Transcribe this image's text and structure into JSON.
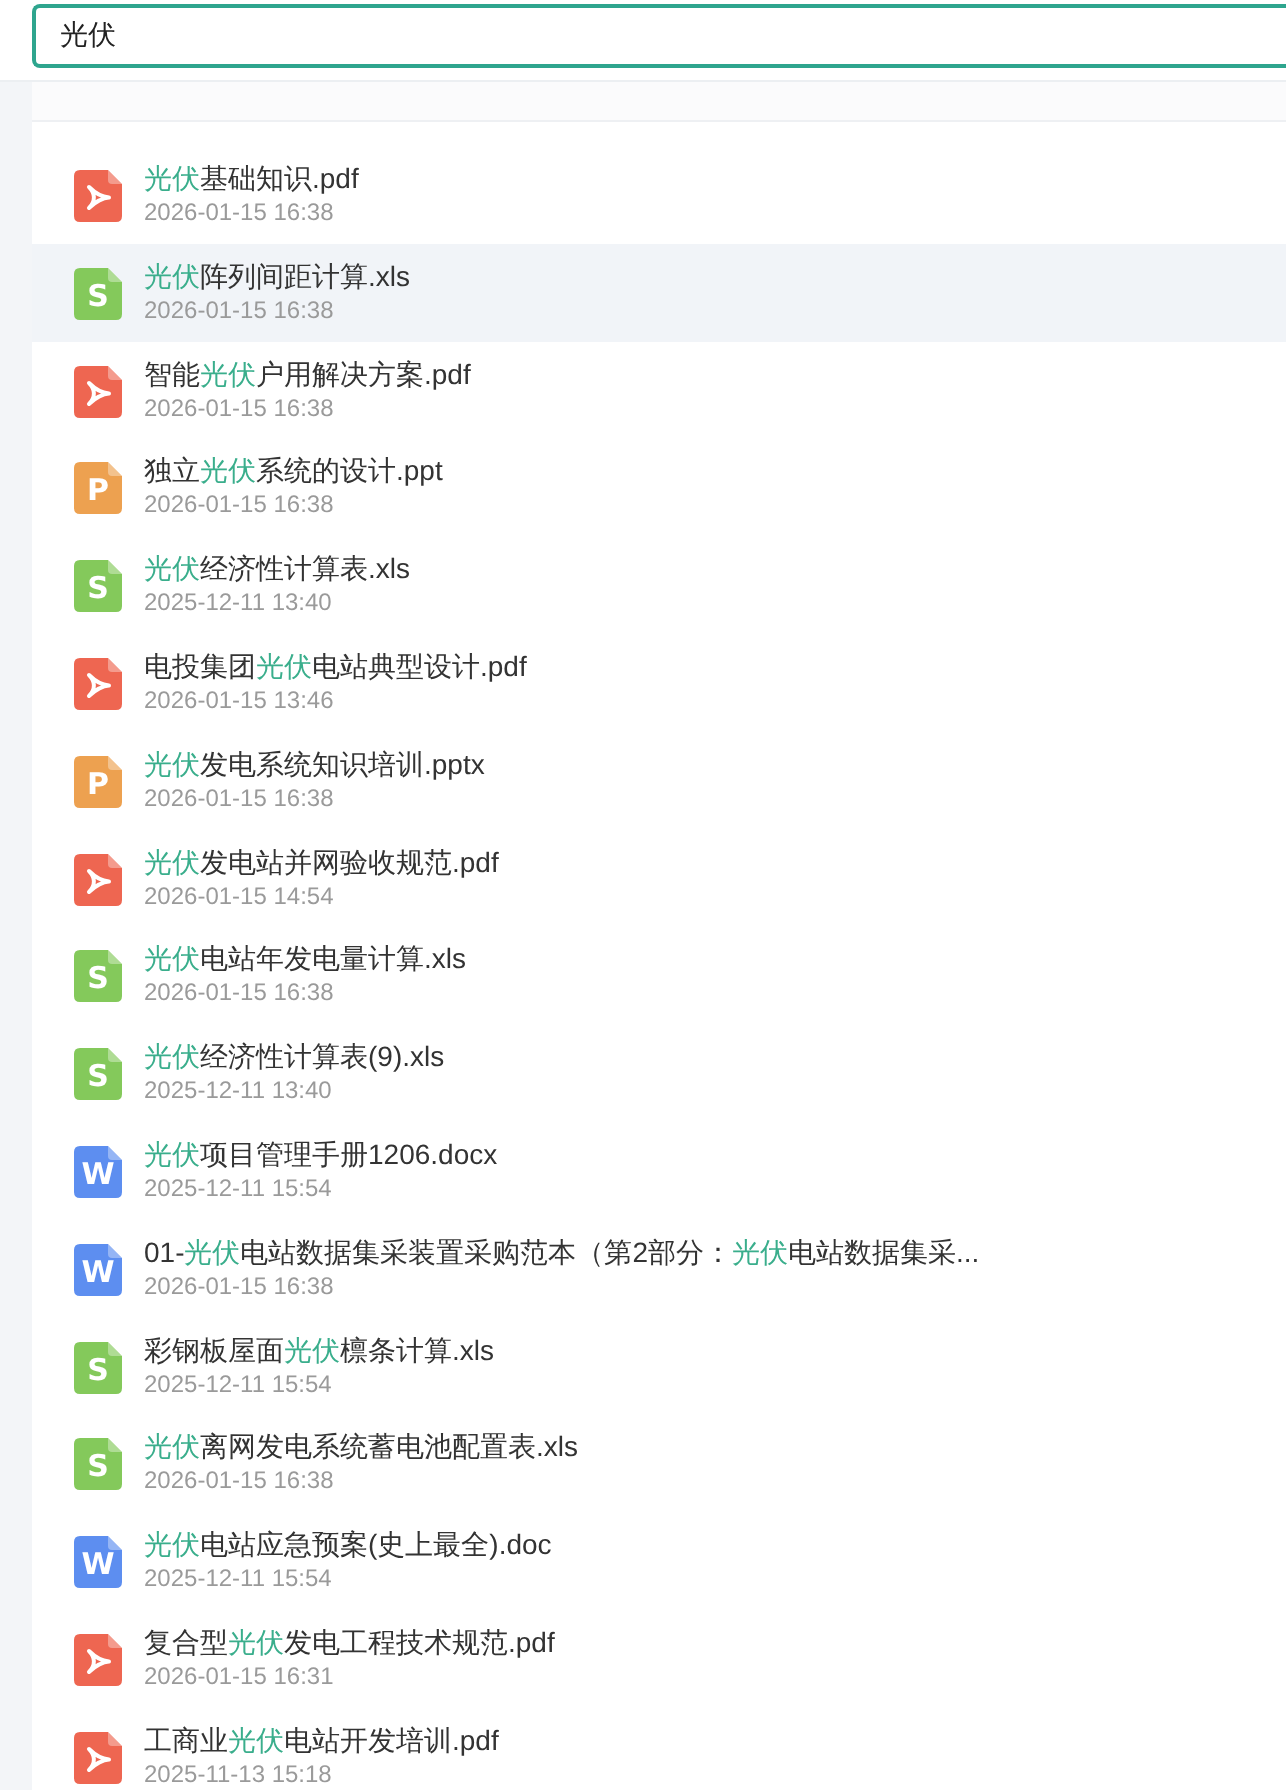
{
  "search": {
    "value": "光伏"
  },
  "results": [
    {
      "kind": "pdf",
      "name": [
        {
          "text": "光伏",
          "match": true
        },
        {
          "text": "基础知识.pdf",
          "match": false
        }
      ],
      "date": "2026-01-15 16:38",
      "selected": false
    },
    {
      "kind": "xls",
      "icon_letter": "S",
      "name": [
        {
          "text": "光伏",
          "match": true
        },
        {
          "text": "阵列间距计算.xls",
          "match": false
        }
      ],
      "date": "2026-01-15 16:38",
      "selected": true
    },
    {
      "kind": "pdf",
      "name": [
        {
          "text": "智能",
          "match": false
        },
        {
          "text": "光伏",
          "match": true
        },
        {
          "text": "户用解决方案.pdf",
          "match": false
        }
      ],
      "date": "2026-01-15 16:38",
      "selected": false
    },
    {
      "kind": "ppt",
      "icon_letter": "P",
      "name": [
        {
          "text": "独立",
          "match": false
        },
        {
          "text": "光伏",
          "match": true
        },
        {
          "text": "系统的设计.ppt",
          "match": false
        }
      ],
      "date": "2026-01-15 16:38",
      "selected": false
    },
    {
      "kind": "xls",
      "icon_letter": "S",
      "name": [
        {
          "text": "光伏",
          "match": true
        },
        {
          "text": "经济性计算表.xls",
          "match": false
        }
      ],
      "date": "2025-12-11 13:40",
      "selected": false
    },
    {
      "kind": "pdf",
      "name": [
        {
          "text": "电投集团",
          "match": false
        },
        {
          "text": "光伏",
          "match": true
        },
        {
          "text": "电站典型设计.pdf",
          "match": false
        }
      ],
      "date": "2026-01-15 13:46",
      "selected": false
    },
    {
      "kind": "ppt",
      "icon_letter": "P",
      "name": [
        {
          "text": "光伏",
          "match": true
        },
        {
          "text": "发电系统知识培训.pptx",
          "match": false
        }
      ],
      "date": "2026-01-15 16:38",
      "selected": false
    },
    {
      "kind": "pdf",
      "name": [
        {
          "text": "光伏",
          "match": true
        },
        {
          "text": "发电站并网验收规范.pdf",
          "match": false
        }
      ],
      "date": "2026-01-15 14:54",
      "selected": false
    },
    {
      "kind": "xls",
      "icon_letter": "S",
      "name": [
        {
          "text": "光伏",
          "match": true
        },
        {
          "text": "电站年发电量计算.xls",
          "match": false
        }
      ],
      "date": "2026-01-15 16:38",
      "selected": false
    },
    {
      "kind": "xls",
      "icon_letter": "S",
      "name": [
        {
          "text": "光伏",
          "match": true
        },
        {
          "text": "经济性计算表(9).xls",
          "match": false
        }
      ],
      "date": "2025-12-11 13:40",
      "selected": false
    },
    {
      "kind": "doc",
      "icon_letter": "W",
      "name": [
        {
          "text": "光伏",
          "match": true
        },
        {
          "text": "项目管理手册1206.docx",
          "match": false
        }
      ],
      "date": "2025-12-11 15:54",
      "selected": false
    },
    {
      "kind": "doc",
      "icon_letter": "W",
      "name": [
        {
          "text": "01-",
          "match": false
        },
        {
          "text": "光伏",
          "match": true
        },
        {
          "text": "电站数据集采装置采购范本（第2部分：",
          "match": false
        },
        {
          "text": "光伏",
          "match": true
        },
        {
          "text": "电站数据集采...",
          "match": false
        }
      ],
      "date": "2026-01-15 16:38",
      "selected": false
    },
    {
      "kind": "xls",
      "icon_letter": "S",
      "name": [
        {
          "text": "彩钢板屋面",
          "match": false
        },
        {
          "text": "光伏",
          "match": true
        },
        {
          "text": "檩条计算.xls",
          "match": false
        }
      ],
      "date": "2025-12-11 15:54",
      "selected": false
    },
    {
      "kind": "xls",
      "icon_letter": "S",
      "name": [
        {
          "text": "光伏",
          "match": true
        },
        {
          "text": "离网发电系统蓄电池配置表.xls",
          "match": false
        }
      ],
      "date": "2026-01-15 16:38",
      "selected": false
    },
    {
      "kind": "doc",
      "icon_letter": "W",
      "name": [
        {
          "text": "光伏",
          "match": true
        },
        {
          "text": "电站应急预案(史上最全).doc",
          "match": false
        }
      ],
      "date": "2025-12-11 15:54",
      "selected": false
    },
    {
      "kind": "pdf",
      "name": [
        {
          "text": "复合型",
          "match": false
        },
        {
          "text": "光伏",
          "match": true
        },
        {
          "text": "发电工程技术规范.pdf",
          "match": false
        }
      ],
      "date": "2026-01-15 16:31",
      "selected": false
    },
    {
      "kind": "pdf",
      "name": [
        {
          "text": "工商业",
          "match": false
        },
        {
          "text": "光伏",
          "match": true
        },
        {
          "text": "电站开发培训.pdf",
          "match": false
        }
      ],
      "date": "2025-11-13 15:18",
      "selected": false
    }
  ]
}
